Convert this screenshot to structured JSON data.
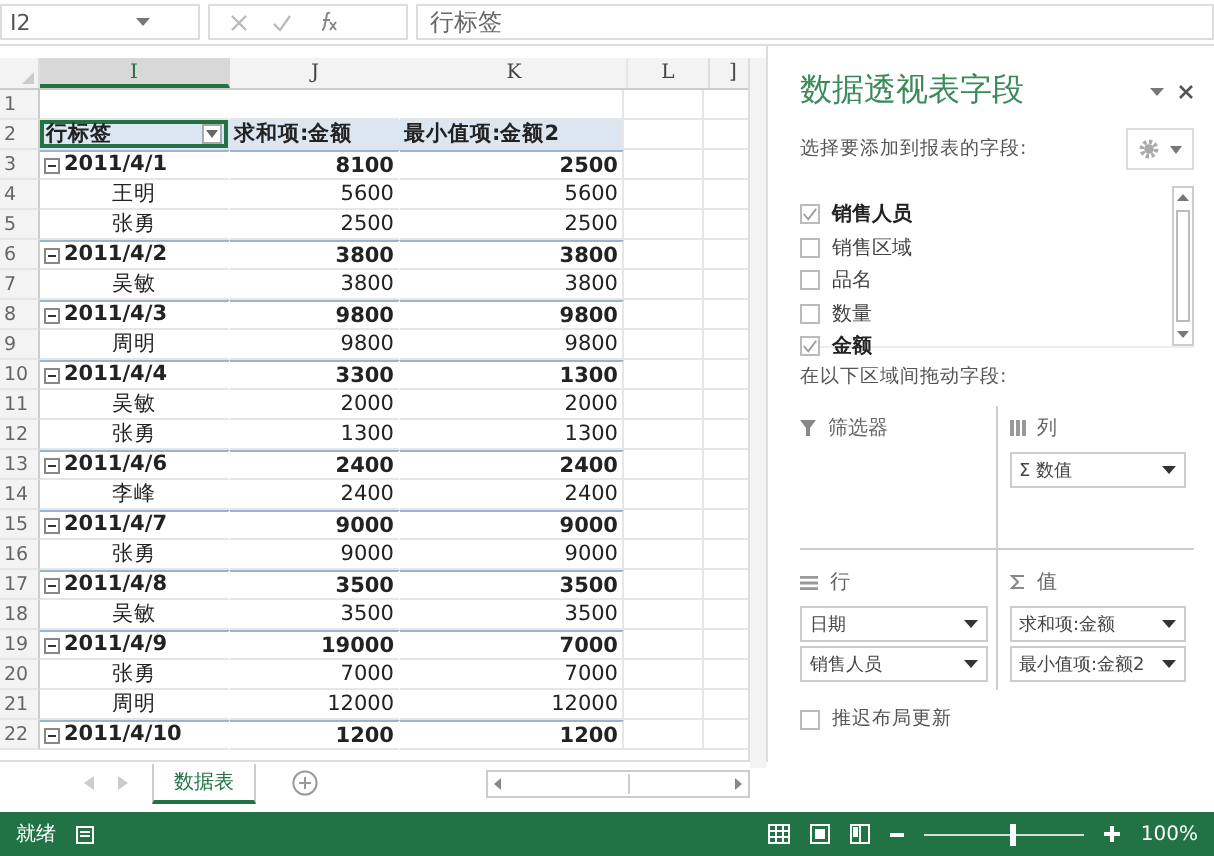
{
  "formula_bar": {
    "name_box": "I2",
    "formula": "行标签"
  },
  "columns": [
    {
      "label": "I",
      "selected": true
    },
    {
      "label": "J",
      "selected": false
    },
    {
      "label": "K",
      "selected": false
    },
    {
      "label": "L",
      "selected": false
    },
    {
      "label": "]",
      "selected": false
    }
  ],
  "rows": [
    {
      "number": "1",
      "kind": "empty",
      "cells": []
    },
    {
      "number": "2",
      "kind": "header",
      "cells": [
        "行标签",
        "求和项:金额",
        "最小值项:金额2"
      ]
    },
    {
      "number": "3",
      "kind": "group",
      "expanded": true,
      "cells": [
        "2011/4/1",
        "8100",
        "2500"
      ]
    },
    {
      "number": "4",
      "kind": "item",
      "cells": [
        "王明",
        "5600",
        "5600"
      ]
    },
    {
      "number": "5",
      "kind": "item",
      "cells": [
        "张勇",
        "2500",
        "2500"
      ]
    },
    {
      "number": "6",
      "kind": "group",
      "expanded": true,
      "cells": [
        "2011/4/2",
        "3800",
        "3800"
      ]
    },
    {
      "number": "7",
      "kind": "item",
      "cells": [
        "吴敏",
        "3800",
        "3800"
      ]
    },
    {
      "number": "8",
      "kind": "group",
      "expanded": true,
      "cells": [
        "2011/4/3",
        "9800",
        "9800"
      ]
    },
    {
      "number": "9",
      "kind": "item",
      "cells": [
        "周明",
        "9800",
        "9800"
      ]
    },
    {
      "number": "10",
      "kind": "group",
      "expanded": true,
      "cells": [
        "2011/4/4",
        "3300",
        "1300"
      ]
    },
    {
      "number": "11",
      "kind": "item",
      "cells": [
        "吴敏",
        "2000",
        "2000"
      ]
    },
    {
      "number": "12",
      "kind": "item",
      "cells": [
        "张勇",
        "1300",
        "1300"
      ]
    },
    {
      "number": "13",
      "kind": "group",
      "expanded": true,
      "cells": [
        "2011/4/6",
        "2400",
        "2400"
      ]
    },
    {
      "number": "14",
      "kind": "item",
      "cells": [
        "李峰",
        "2400",
        "2400"
      ]
    },
    {
      "number": "15",
      "kind": "group",
      "expanded": true,
      "cells": [
        "2011/4/7",
        "9000",
        "9000"
      ]
    },
    {
      "number": "16",
      "kind": "item",
      "cells": [
        "张勇",
        "9000",
        "9000"
      ]
    },
    {
      "number": "17",
      "kind": "group",
      "expanded": true,
      "cells": [
        "2011/4/8",
        "3500",
        "3500"
      ]
    },
    {
      "number": "18",
      "kind": "item",
      "cells": [
        "吴敏",
        "3500",
        "3500"
      ]
    },
    {
      "number": "19",
      "kind": "group",
      "expanded": true,
      "cells": [
        "2011/4/9",
        "19000",
        "7000"
      ]
    },
    {
      "number": "20",
      "kind": "item",
      "cells": [
        "张勇",
        "7000",
        "7000"
      ]
    },
    {
      "number": "21",
      "kind": "item",
      "cells": [
        "周明",
        "12000",
        "12000"
      ]
    },
    {
      "number": "22",
      "kind": "group",
      "expanded": true,
      "cells": [
        "2011/4/10",
        "1200",
        "1200"
      ]
    }
  ],
  "sheet_tabs": [
    {
      "label": "数据表",
      "selected": true
    }
  ],
  "panel": {
    "title": "数据透视表字段",
    "prompt": "选择要添加到报表的字段:",
    "fields": [
      {
        "label": "销售人员",
        "checked": true
      },
      {
        "label": "销售区域",
        "checked": false
      },
      {
        "label": "品名",
        "checked": false
      },
      {
        "label": "数量",
        "checked": false
      },
      {
        "label": "金额",
        "checked": true
      }
    ],
    "drag_hint": "在以下区域间拖动字段:",
    "areas": [
      {
        "kind": "filter",
        "label": "筛选器"
      },
      {
        "kind": "columns",
        "label": "列",
        "items": [
          "Σ 数值"
        ]
      },
      {
        "kind": "rows",
        "label": "行",
        "items": [
          "日期",
          "销售人员"
        ]
      },
      {
        "kind": "values",
        "label": "值",
        "items": [
          "求和项:金额",
          "最小值项:金额2"
        ]
      }
    ],
    "defer": {
      "label": "推迟布局更新",
      "checked": false
    }
  },
  "status_bar": {
    "status": "就绪",
    "zoom": "100%",
    "level": 0.55
  }
}
